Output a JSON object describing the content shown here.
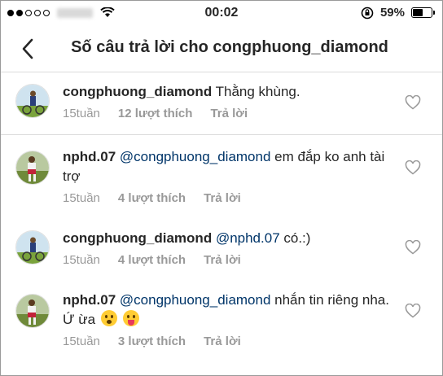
{
  "status_bar": {
    "time": "00:02",
    "battery_percent": "59%",
    "battery_level": 0.59
  },
  "header": {
    "title": "Số câu trả lời cho congphuong_diamond",
    "back_icon": "chevron-left-icon"
  },
  "comments": [
    {
      "username": "congphuong_diamond",
      "mention": "",
      "text": " Thằng khùng.",
      "age": "15tuần",
      "likes": "12 lượt thích",
      "reply": "Trả lời"
    },
    {
      "username": "nphd.07",
      "mention": "@congphuong_diamond",
      "text": " em đắp ko anh tài trợ",
      "age": "15tuần",
      "likes": "4 lượt thích",
      "reply": "Trả lời"
    },
    {
      "username": "congphuong_diamond",
      "mention": "@nphd.07",
      "text": " có.:)",
      "age": "15tuần",
      "likes": "4 lượt thích",
      "reply": "Trả lời"
    },
    {
      "username": "nphd.07",
      "mention": "@congphuong_diamond",
      "text": " nhắn tin riêng nha. Ứ ừa",
      "emojis": [
        "hushed-face-emoji",
        "tongue-face-emoji"
      ],
      "age": "15tuần",
      "likes": "3 lượt thích",
      "reply": "Trả lời"
    }
  ]
}
